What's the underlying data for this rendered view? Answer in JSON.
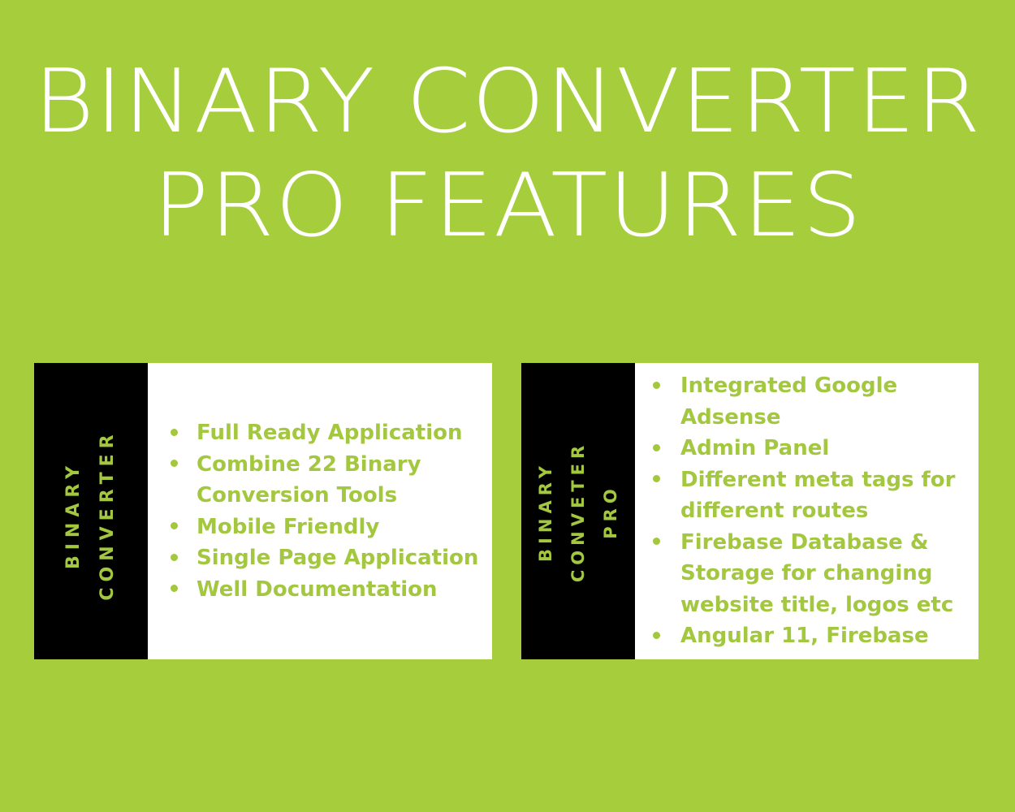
{
  "theme": {
    "background_green": "#a6ce3c",
    "accent_green": "#a3c73f",
    "panel_black": "#000000",
    "card_white": "#ffffff",
    "title_white": "#ffffff"
  },
  "title": {
    "line1": "BINARY CONVERTER",
    "line2": "PRO FEATURES",
    "full": "BINARY CONVERTER PRO FEATURES"
  },
  "cards": [
    {
      "id": "binary-converter",
      "label_lines": [
        "BINARY",
        "CONVERTER"
      ],
      "features": [
        "Full Ready Application",
        "Combine 22  Binary Conversion Tools",
        "Mobile Friendly",
        "Single Page Application",
        "Well Documentation"
      ]
    },
    {
      "id": "binary-converter-pro",
      "label_lines": [
        "BINARY",
        "CONVETER",
        "PRO"
      ],
      "features": [
        "Integrated Google Adsense",
        "Admin Panel",
        "Different meta tags for different routes",
        "Firebase Database & Storage for changing website title, logos etc",
        "Angular 11, Firebase"
      ]
    }
  ]
}
